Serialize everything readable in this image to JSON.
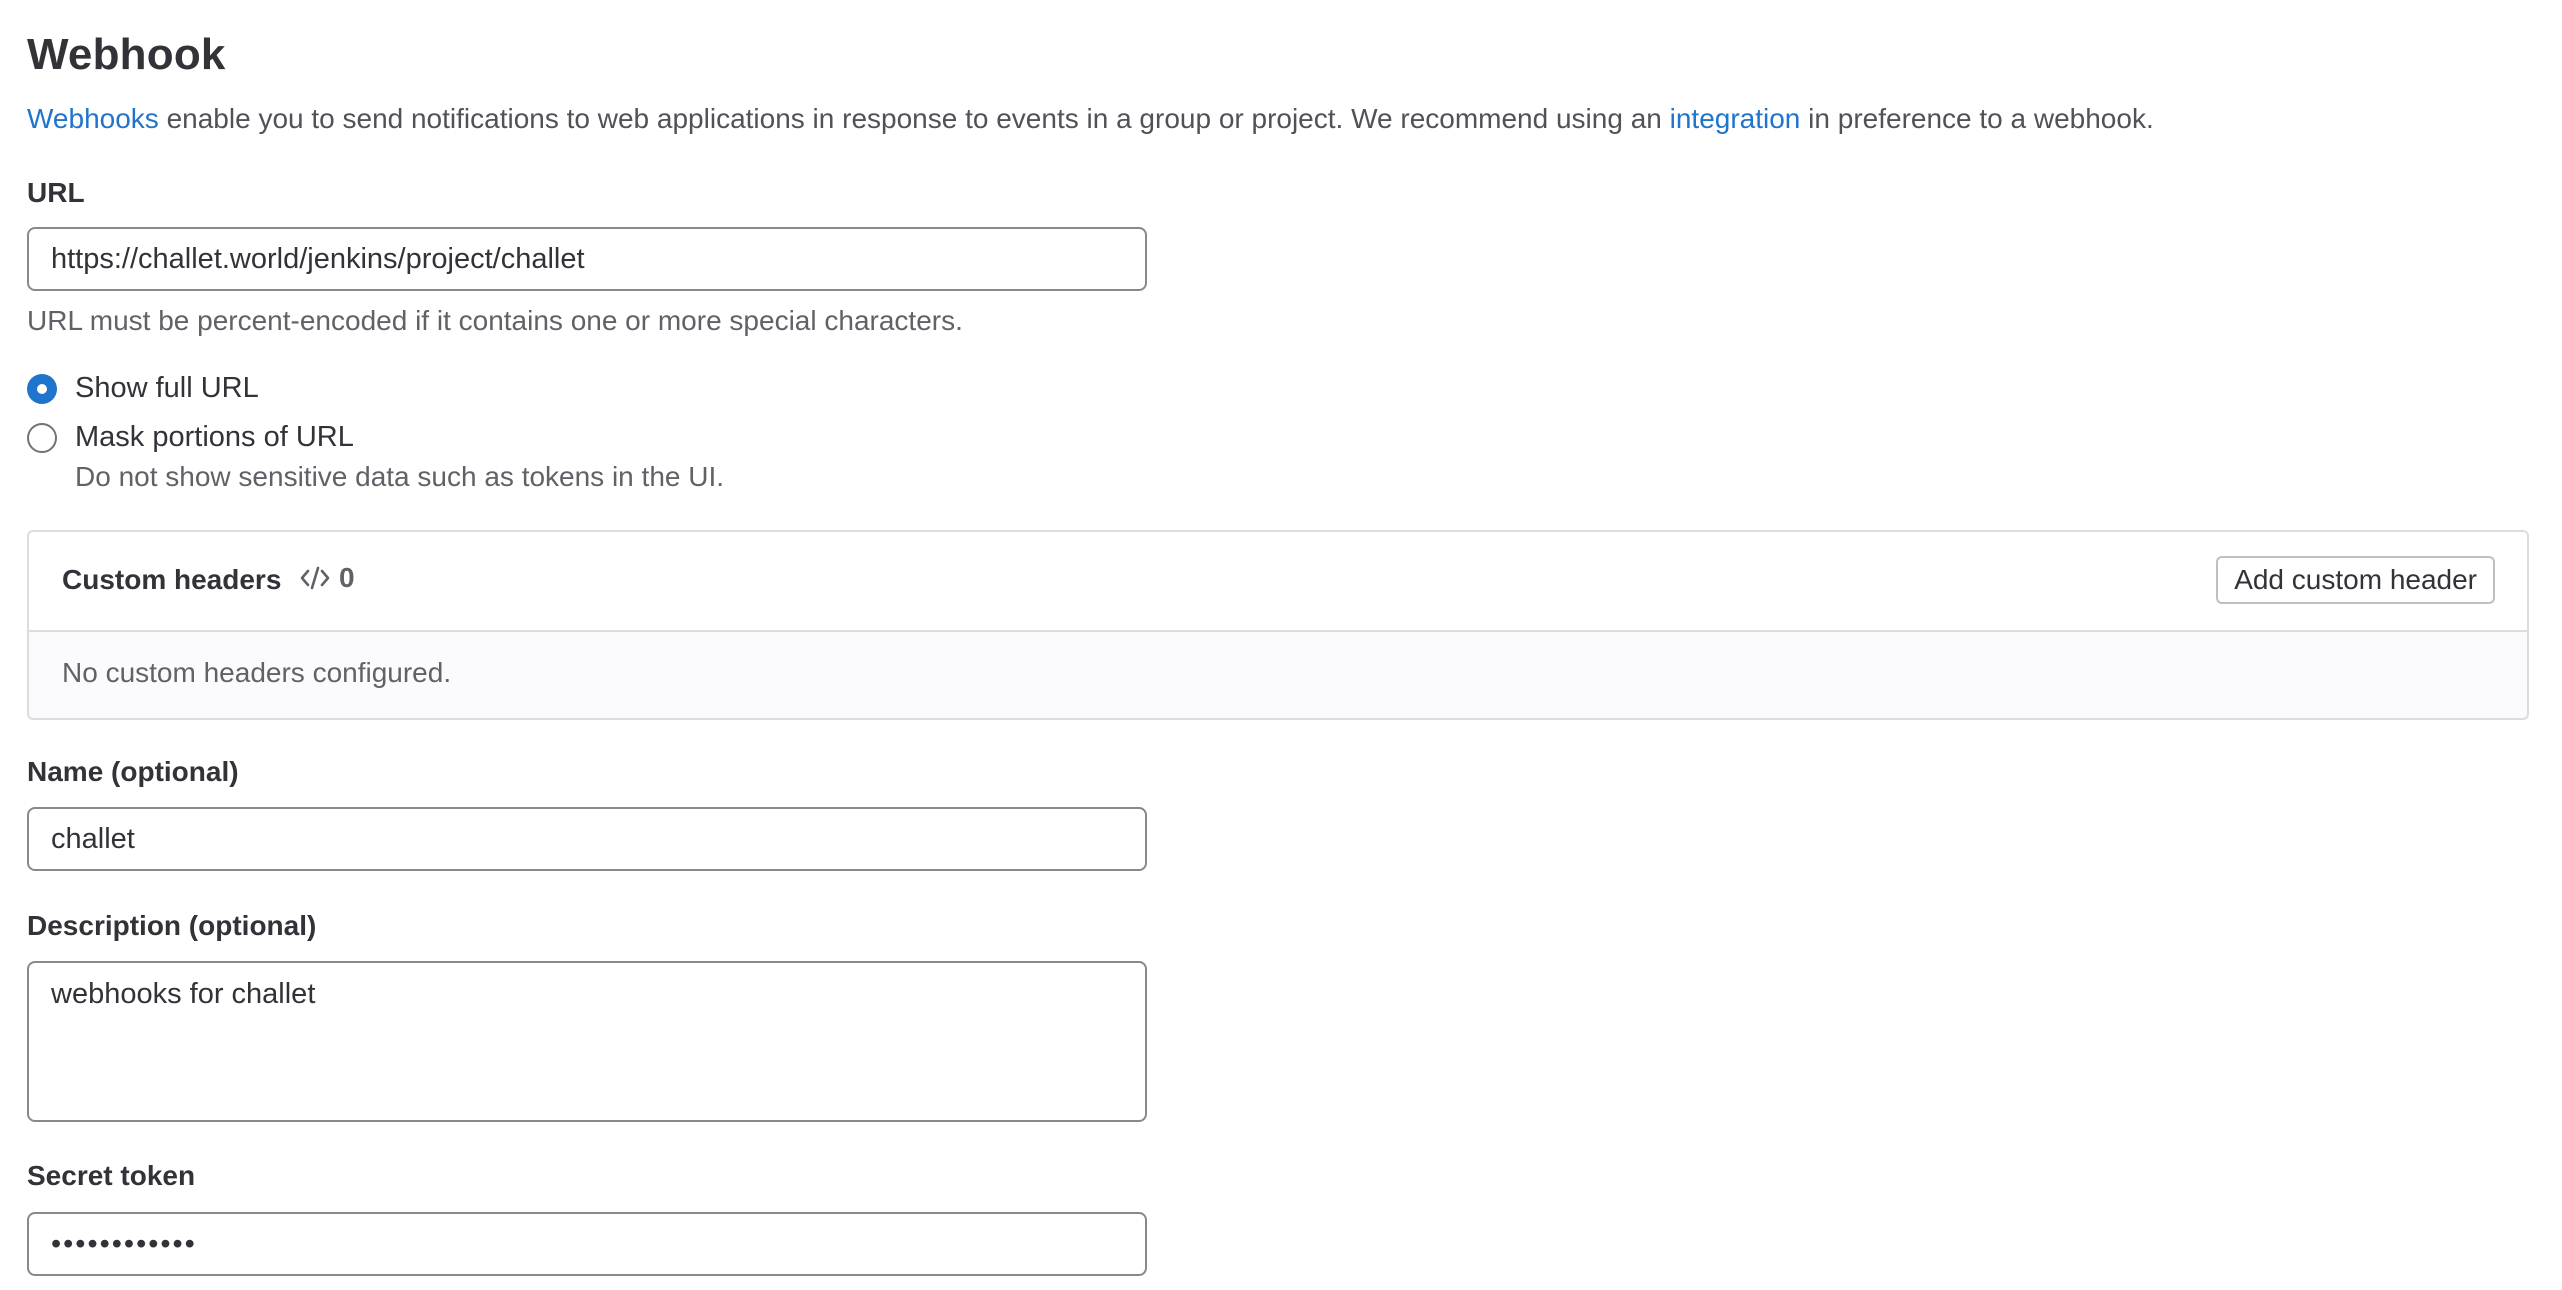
{
  "heading": "Webhook",
  "intro": {
    "link1": "Webhooks",
    "text1": " enable you to send notifications to web applications in response to events in a group or project. We recommend using an ",
    "link2": "integration",
    "text2": " in preference to a webhook."
  },
  "url": {
    "label": "URL",
    "value": "https://challet.world/jenkins/project/challet",
    "help": "URL must be percent-encoded if it contains one or more special characters."
  },
  "url_display": {
    "show_full_label": "Show full URL",
    "show_full_selected": true,
    "mask_label": "Mask portions of URL",
    "mask_help": "Do not show sensitive data such as tokens in the UI."
  },
  "custom_headers": {
    "title": "Custom headers",
    "count": "0",
    "add_button": "Add custom header",
    "empty_text": "No custom headers configured."
  },
  "name": {
    "label": "Name (optional)",
    "value": "challet"
  },
  "description": {
    "label": "Description (optional)",
    "value": "webhooks for challet"
  },
  "secret_token": {
    "label": "Secret token",
    "value": "••••••••••••"
  },
  "colors": {
    "link": "#1f75cb",
    "radio_selected": "#1f75cb"
  }
}
